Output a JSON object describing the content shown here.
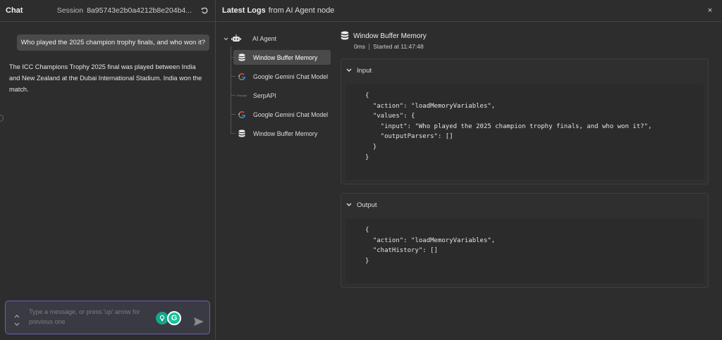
{
  "chat": {
    "title": "Chat",
    "session_label": "Session",
    "session_id": "8a95743e2b0a4212b8e204b4...",
    "user_message": "Who played the 2025 champion trophy finals, and who won it?",
    "bot_message": "The ICC Champions Trophy 2025 final was played between India and New Zealand at the Dubai International Stadium. India won the match.",
    "input_placeholder": "Type a message, or press 'up' arrow for previous one",
    "ext_icon_letter": "G"
  },
  "logs": {
    "title": "Latest Logs",
    "subtitle": "from AI Agent node",
    "close": "×",
    "tree": {
      "root": "AI Agent",
      "items": [
        {
          "label": "Window Buffer Memory",
          "icon": "database-icon",
          "active": true
        },
        {
          "label": "Google Gemini Chat Model",
          "icon": "google-icon",
          "active": false
        },
        {
          "label": "SerpAPI",
          "icon": "serpapi-icon",
          "active": false,
          "icon_text": "SerpApi"
        },
        {
          "label": "Google Gemini Chat Model",
          "icon": "google-icon",
          "active": false
        },
        {
          "label": "Window Buffer Memory",
          "icon": "database-icon",
          "active": false
        }
      ]
    },
    "detail": {
      "title": "Window Buffer Memory",
      "duration": "0ms",
      "started": "Started at 11:47:48"
    },
    "input": {
      "label": "Input",
      "code": "{\n  \"action\": \"loadMemoryVariables\",\n  \"values\": {\n    \"input\": \"Who played the 2025 champion trophy finals, and who won it?\",\n    \"outputParsers\": []\n  }\n}"
    },
    "output": {
      "label": "Output",
      "code": "{\n  \"action\": \"loadMemoryVariables\",\n  \"chatHistory\": []\n}"
    }
  },
  "colors": {
    "background": "#2d2d2d",
    "active_item": "#4a4a4a",
    "input_border": "#6b5fb3",
    "grammarly": "#15c39a"
  }
}
